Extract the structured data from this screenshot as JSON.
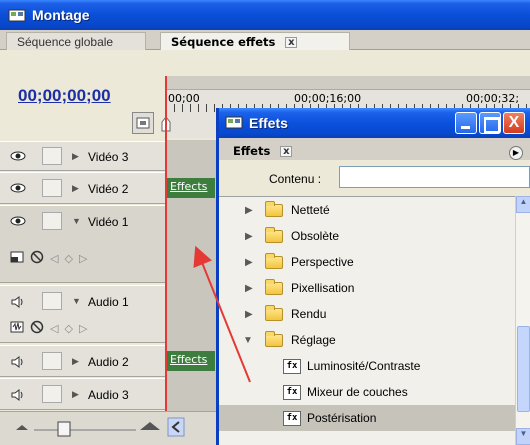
{
  "montage": {
    "title": "Montage",
    "tabs": [
      {
        "label": "Séquence globale"
      },
      {
        "label": "Séquence effets",
        "close": "x"
      }
    ],
    "timecode": "00;00;00;00",
    "ruler_labels": [
      "00;00",
      "00;00;16;00",
      "00;00;32;"
    ],
    "tracks": [
      {
        "name": "Vidéo 3"
      },
      {
        "name": "Vidéo 2"
      },
      {
        "name": "Vidéo 1"
      },
      {
        "name": "Audio 1"
      },
      {
        "name": "Audio 2"
      },
      {
        "name": "Audio 3"
      }
    ],
    "clips": [
      {
        "label": "Effects"
      },
      {
        "label": "Effects"
      }
    ]
  },
  "effets_window": {
    "title": "Effets",
    "tab_label": "Effets",
    "tab_close": "x",
    "contenu_label": "Contenu :",
    "contenu_value": "",
    "tree": [
      {
        "label": "Netteté",
        "type": "folder",
        "expanded": false
      },
      {
        "label": "Obsolète",
        "type": "folder",
        "expanded": false
      },
      {
        "label": "Perspective",
        "type": "folder",
        "expanded": false
      },
      {
        "label": "Pixellisation",
        "type": "folder",
        "expanded": false
      },
      {
        "label": "Rendu",
        "type": "folder",
        "expanded": false
      },
      {
        "label": "Réglage",
        "type": "folder",
        "expanded": true
      },
      {
        "label": "Luminosité/Contraste",
        "type": "effect"
      },
      {
        "label": "Mixeur de couches",
        "type": "effect"
      },
      {
        "label": "Postérisation",
        "type": "effect",
        "selected": true
      }
    ],
    "close_glyph": "X"
  },
  "colors": {
    "title_blue": "#0a4fd8",
    "playhead_red": "#e53935",
    "clip_green": "#3d7d3d",
    "timecode_blue": "#1c2fa6"
  }
}
